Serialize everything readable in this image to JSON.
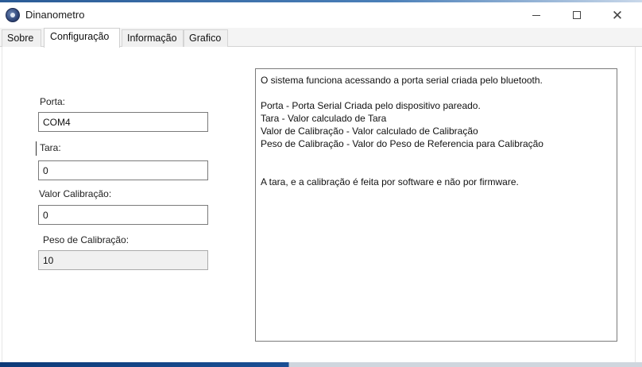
{
  "window": {
    "title": "Dinanometro",
    "controls": {
      "minimize": "—",
      "maximize": "☐",
      "close": "✕"
    }
  },
  "tabs": [
    {
      "label": "Sobre",
      "active": false
    },
    {
      "label": "Configuração",
      "active": true
    },
    {
      "label": "Informação",
      "active": false
    },
    {
      "label": "Grafico",
      "active": false
    }
  ],
  "config": {
    "porta": {
      "label": "Porta:",
      "value": "COM4"
    },
    "tara": {
      "label": "Tara:",
      "value": "0"
    },
    "valor_calibracao": {
      "label": "Valor Calibração:",
      "value": "0"
    },
    "peso_calibracao": {
      "label": "Peso de Calibração:",
      "value": "10"
    }
  },
  "info": {
    "line1": "O sistema funciona acessando a porta serial criada pelo bluetooth.",
    "line2": "Porta - Porta Serial Criada pelo dispositivo pareado.",
    "line3": "Tara - Valor calculado de Tara",
    "line4": "Valor de Calibração - Valor calculado de Calibração",
    "line5": "Peso de Calibração - Valor do Peso de Referencia para Calibração",
    "line6": "A tara, e a calibração é feita por software e não por firmware."
  },
  "colors": {
    "accent_bar": "#1a4f94",
    "field_border": "#7a7a7a",
    "readonly_bg": "#f0f0f0"
  },
  "icons": {
    "app": "app-gauge-icon",
    "cursor": "text-cursor-icon"
  }
}
